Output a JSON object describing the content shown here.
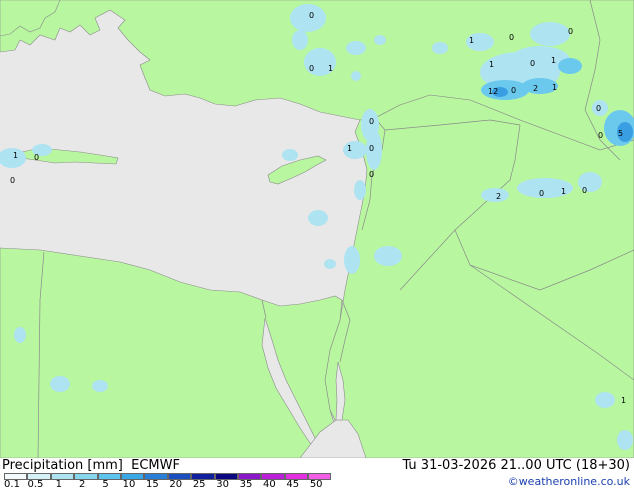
{
  "header": {
    "precip_label": "Precipitation [mm]",
    "model": "ECMWF",
    "valid_time": "Tu 31-03-2026 21..00 UTC (18+30)",
    "credit": "©weatheronline.co.uk"
  },
  "legend": {
    "ticks": [
      "0.1",
      "0.5",
      "1",
      "2",
      "5",
      "10",
      "15",
      "20",
      "25",
      "30",
      "35",
      "40",
      "45",
      "50"
    ],
    "colors": [
      "#f5fbfc",
      "#d6f0f7",
      "#aee3f2",
      "#86d6ef",
      "#5ec6ee",
      "#3aa8e6",
      "#2a7fd6",
      "#1b4fc0",
      "#10209d",
      "#0a0780",
      "#8b18c8",
      "#bb20d8",
      "#e22fe0",
      "#f25fe6"
    ]
  },
  "map_colors": {
    "sea": "#e8e8e8",
    "land": "#b8f7a0",
    "border": "#8a8a8a",
    "light_precip": "#aee3f2",
    "moderate_precip": "#6cc9ee",
    "heavy_precip": "#3a9ee2"
  },
  "map_labels": [
    "0",
    "1",
    "0",
    "0",
    "1",
    "0",
    "1",
    "0",
    "1",
    "12",
    "0",
    "2",
    "1",
    "0",
    "5",
    "0",
    "1",
    "0",
    "0",
    "1",
    "0",
    "2",
    "0",
    "1",
    "0",
    "0",
    "0",
    "1"
  ]
}
